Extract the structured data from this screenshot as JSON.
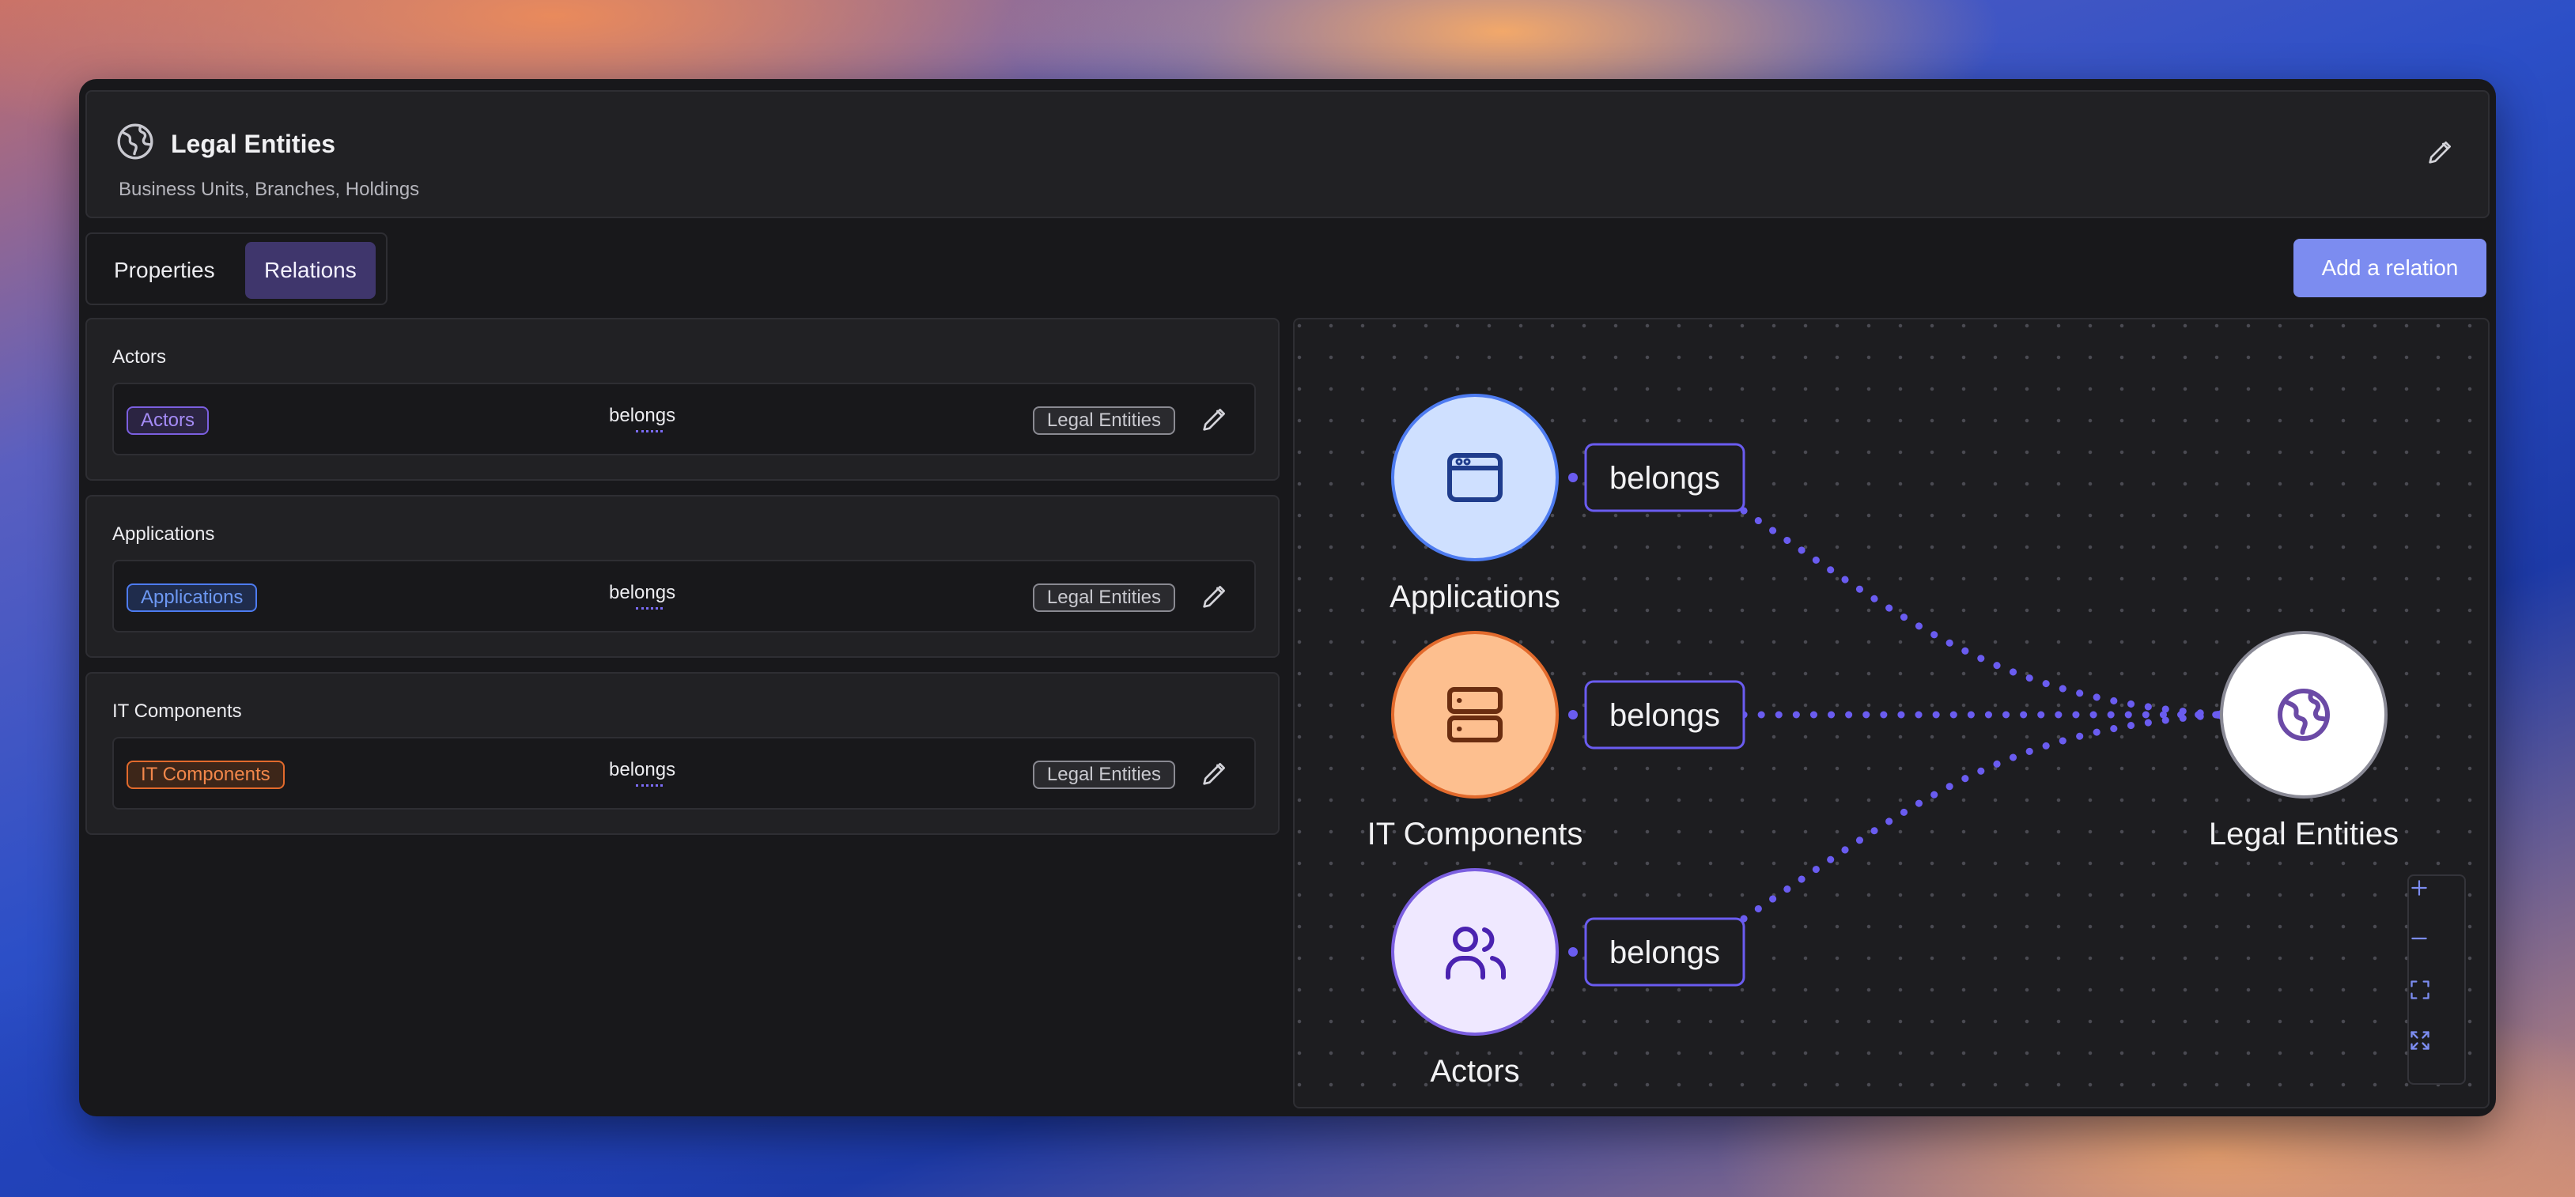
{
  "header": {
    "title": "Legal Entities",
    "subtitle": "Business Units, Branches, Holdings",
    "icon": "globe-icon"
  },
  "tabs": [
    {
      "label": "Properties",
      "active": false
    },
    {
      "label": "Relations",
      "active": true
    }
  ],
  "add_relation_label": "Add a relation",
  "relations": [
    {
      "title": "Actors",
      "source": "Actors",
      "verb": "belongs",
      "target": "Legal Entities"
    },
    {
      "title": "Applications",
      "source": "Applications",
      "verb": "belongs",
      "target": "Legal Entities"
    },
    {
      "title": "IT Components",
      "source": "IT Components",
      "verb": "belongs",
      "target": "Legal Entities"
    }
  ],
  "graph": {
    "nodes": [
      {
        "label": "Applications",
        "icon": "browser-window-icon",
        "color": "#cfe0ff"
      },
      {
        "label": "IT Components",
        "icon": "server-icon",
        "color": "#fdbf8f"
      },
      {
        "label": "Actors",
        "icon": "users-icon",
        "color": "#efe8ff"
      },
      {
        "label": "Legal Entities",
        "icon": "globe-icon",
        "color": "#ffffff"
      }
    ],
    "edges": [
      {
        "label": "belongs"
      },
      {
        "label": "belongs"
      },
      {
        "label": "belongs"
      }
    ],
    "controls": [
      "zoom-in-icon",
      "zoom-out-icon",
      "fit-view-icon",
      "expand-icon"
    ]
  },
  "colors": {
    "accent": "#7c8cf0",
    "edge": "#6a5cf0",
    "actors": "#7b5fe0",
    "applications": "#4d7bf0",
    "it_components": "#e26a2c"
  }
}
